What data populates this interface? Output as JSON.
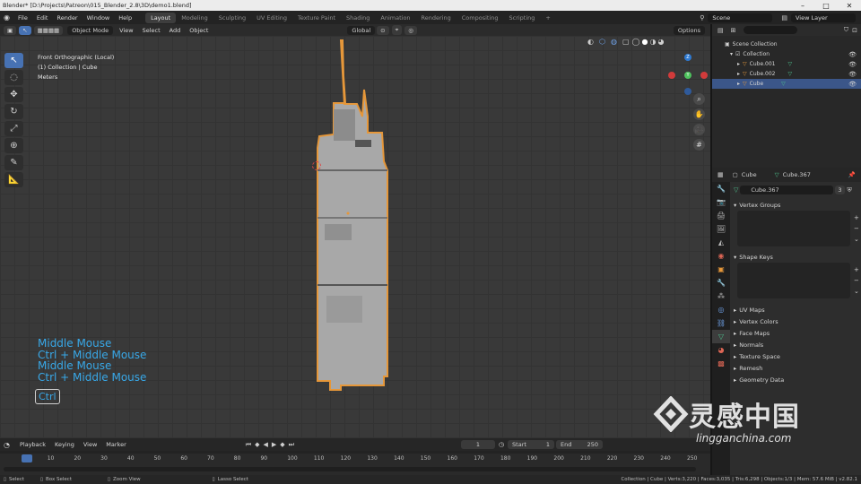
{
  "titlebar": {
    "text": "Blender* [D:\\Projects\\Patreon\\015_Blender_2.8\\3D\\demo1.blend]"
  },
  "menu": [
    "File",
    "Edit",
    "Render",
    "Window",
    "Help"
  ],
  "workspaces": [
    "Layout",
    "Modeling",
    "Sculpting",
    "UV Editing",
    "Texture Paint",
    "Shading",
    "Animation",
    "Rendering",
    "Compositing",
    "Scripting"
  ],
  "workspace_add": "+",
  "scene": "Scene",
  "view_layer": "View Layer",
  "viewport_header": {
    "mode": "Object Mode",
    "menus": [
      "View",
      "Select",
      "Add",
      "Object"
    ],
    "orientation": "Global",
    "options": "Options"
  },
  "viewport": {
    "view_name": "Front Orthographic (Local)",
    "collection_info": "(1) Collection | Cube",
    "units": "Meters",
    "shortcuts": [
      "Middle Mouse",
      "Ctrl + Middle Mouse",
      "Middle Mouse",
      "Ctrl + Middle Mouse"
    ],
    "key_badge": "Ctrl",
    "gizmo": {
      "z": "Z",
      "y": "Y"
    }
  },
  "timeline": {
    "menus": [
      "Playback",
      "Keying",
      "View",
      "Marker"
    ],
    "current_frame": "1",
    "start_label": "Start",
    "start": "1",
    "end_label": "End",
    "end": "250",
    "frame_ticks": [
      "1",
      "10",
      "20",
      "30",
      "40",
      "50",
      "60",
      "70",
      "80",
      "90",
      "100",
      "110",
      "120",
      "130",
      "140",
      "150",
      "160",
      "170",
      "180",
      "190",
      "200",
      "210",
      "220",
      "230",
      "240",
      "250"
    ]
  },
  "statusbar": {
    "items": [
      "Select",
      "Box Select",
      "Zoom View",
      "Lasso Select"
    ],
    "info": "Collection | Cube | Verts:3,220 | Faces:3,035 | Tris:6,298 | Objects:1/3 | Mem: 57.6 MiB | v2.82.1"
  },
  "outliner": {
    "root": "Scene Collection",
    "items": [
      {
        "name": "Collection",
        "selected": false
      },
      {
        "name": "Cube.001",
        "selected": false
      },
      {
        "name": "Cube.002",
        "selected": false
      },
      {
        "name": "Cube",
        "selected": true
      }
    ]
  },
  "properties": {
    "object_name": "Cube",
    "mesh_name": "Cube.367",
    "data_field": "Cube.367",
    "user_count": "3",
    "panels_open": [
      "Vertex Groups",
      "Shape Keys"
    ],
    "panels_closed": [
      "UV Maps",
      "Vertex Colors",
      "Face Maps",
      "Normals",
      "Texture Space",
      "Remesh",
      "Geometry Data"
    ]
  },
  "watermark": {
    "cn": "灵感中国",
    "en": "lingganchina.com"
  },
  "colors": {
    "accent": "#4772b3",
    "selection_orange": "#e5973a",
    "shortcut_blue": "#38a8e8"
  }
}
